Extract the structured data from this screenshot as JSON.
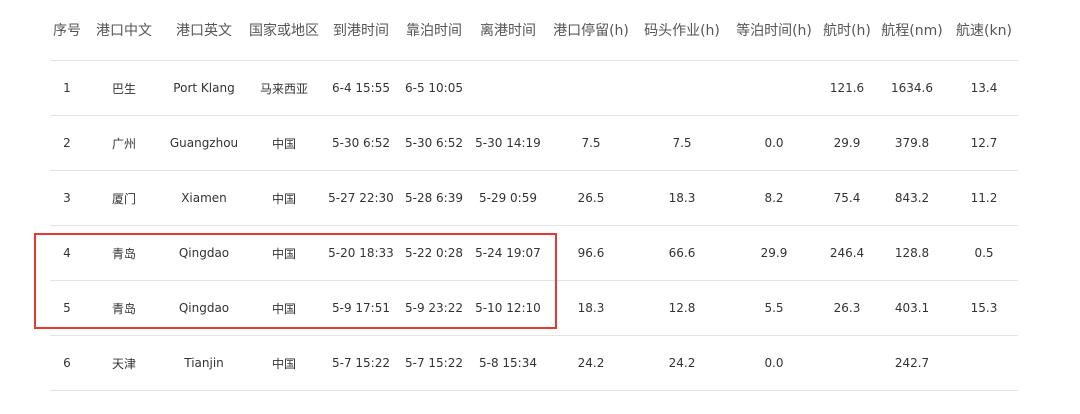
{
  "table": {
    "headers": [
      "序号",
      "港口中文",
      "港口英文",
      "国家或地区",
      "到港时间",
      "靠泊时间",
      "离港时间",
      "港口停留(h)",
      "码头作业(h)",
      "等泊时间(h)",
      "航时(h)",
      "航程(nm)",
      "航速(kn)"
    ],
    "rows": [
      [
        "1",
        "巴生",
        "Port Klang",
        "马来西亚",
        "6-4 15:55",
        "6-5 10:05",
        "",
        "",
        "",
        "",
        "121.6",
        "1634.6",
        "13.4"
      ],
      [
        "2",
        "广州",
        "Guangzhou",
        "中国",
        "5-30 6:52",
        "5-30 6:52",
        "5-30 14:19",
        "7.5",
        "7.5",
        "0.0",
        "29.9",
        "379.8",
        "12.7"
      ],
      [
        "3",
        "厦门",
        "Xiamen",
        "中国",
        "5-27 22:30",
        "5-28 6:39",
        "5-29 0:59",
        "26.5",
        "18.3",
        "8.2",
        "75.4",
        "843.2",
        "11.2"
      ],
      [
        "4",
        "青岛",
        "Qingdao",
        "中国",
        "5-20 18:33",
        "5-22 0:28",
        "5-24 19:07",
        "96.6",
        "66.6",
        "29.9",
        "246.4",
        "128.8",
        "0.5"
      ],
      [
        "5",
        "青岛",
        "Qingdao",
        "中国",
        "5-9 17:51",
        "5-9 23:22",
        "5-10 12:10",
        "18.3",
        "12.8",
        "5.5",
        "26.3",
        "403.1",
        "15.3"
      ],
      [
        "6",
        "天津",
        "Tianjin",
        "中国",
        "5-7 15:22",
        "5-7 15:22",
        "5-8 15:34",
        "24.2",
        "24.2",
        "0.0",
        "",
        "242.7",
        ""
      ]
    ]
  },
  "colors": {
    "highlight_border": "#e53935",
    "row_divider": "#e4e4e4",
    "text": "#333333",
    "header_text": "#555555"
  }
}
